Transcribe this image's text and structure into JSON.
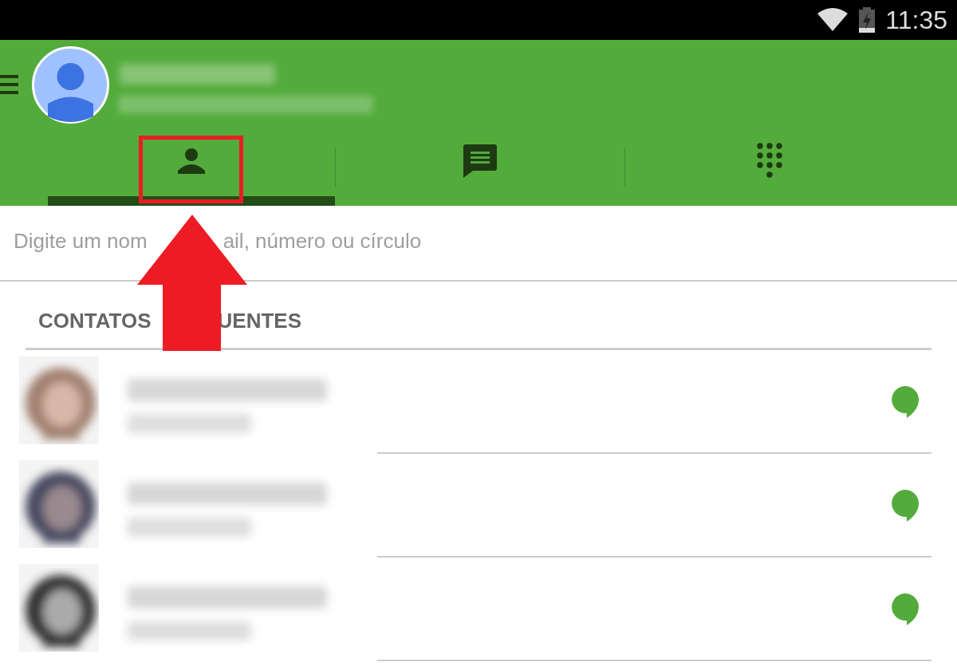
{
  "status_bar": {
    "time": "11:35"
  },
  "tabs": [
    {
      "kind": "people",
      "selected": true
    },
    {
      "kind": "messages",
      "selected": false
    },
    {
      "kind": "dialpad",
      "selected": false
    }
  ],
  "search": {
    "placeholder_parts": [
      "Digite um nom",
      "ail, número ou círculo"
    ]
  },
  "section": {
    "title_parts": [
      "CONTATOS",
      "UENTES"
    ]
  },
  "contacts": [
    {
      "kind": "blurred"
    },
    {
      "kind": "blurred"
    },
    {
      "kind": "blurred"
    }
  ],
  "annotation": {
    "kind": "arrow-and-frame"
  }
}
